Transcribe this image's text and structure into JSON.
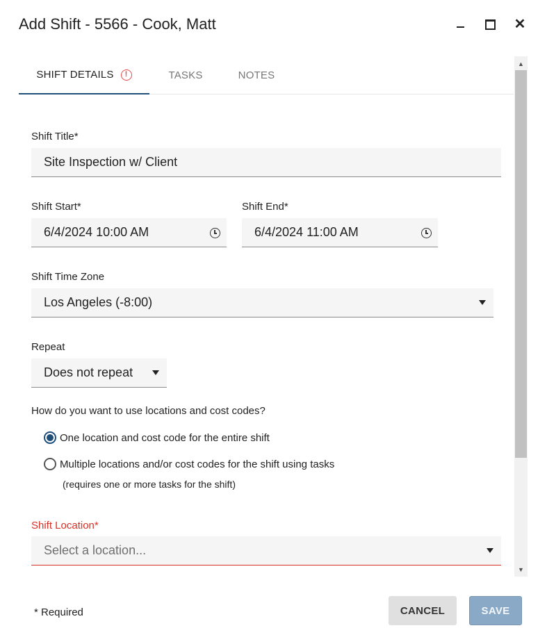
{
  "window": {
    "title": "Add Shift - 5566 - Cook, Matt",
    "minimize_icon": "minimize-icon",
    "maximize_icon": "maximize-icon",
    "close_glyph": "✕"
  },
  "tabs": [
    {
      "label": "SHIFT DETAILS",
      "active": true,
      "badge": "!"
    },
    {
      "label": "TASKS",
      "active": false
    },
    {
      "label": "NOTES",
      "active": false
    }
  ],
  "form": {
    "shift_title": {
      "label": "Shift Title*",
      "value": "Site Inspection w/ Client"
    },
    "shift_start": {
      "label": "Shift Start*",
      "value": "6/4/2024 10:00 AM"
    },
    "shift_end": {
      "label": "Shift End*",
      "value": "6/4/2024 11:00 AM"
    },
    "time_zone": {
      "label": "Shift Time Zone",
      "value": "Los Angeles (-8:00)"
    },
    "repeat": {
      "label": "Repeat",
      "value": "Does not repeat"
    },
    "location_mode": {
      "question": "How do you want to use locations and cost codes?",
      "options": [
        {
          "label": "One location and cost code for the entire shift",
          "checked": true
        },
        {
          "label": "Multiple locations and/or cost codes for the shift using tasks",
          "checked": false
        }
      ],
      "note": "(requires one or more tasks for the shift)"
    },
    "shift_location": {
      "label": "Shift Location*",
      "placeholder": "Select a location..."
    }
  },
  "footer": {
    "required_note": "* Required",
    "cancel_label": "CANCEL",
    "save_label": "SAVE"
  },
  "colors": {
    "accent": "#1f4e79",
    "error": "#d93025",
    "save_button": "#8aa9c6"
  }
}
